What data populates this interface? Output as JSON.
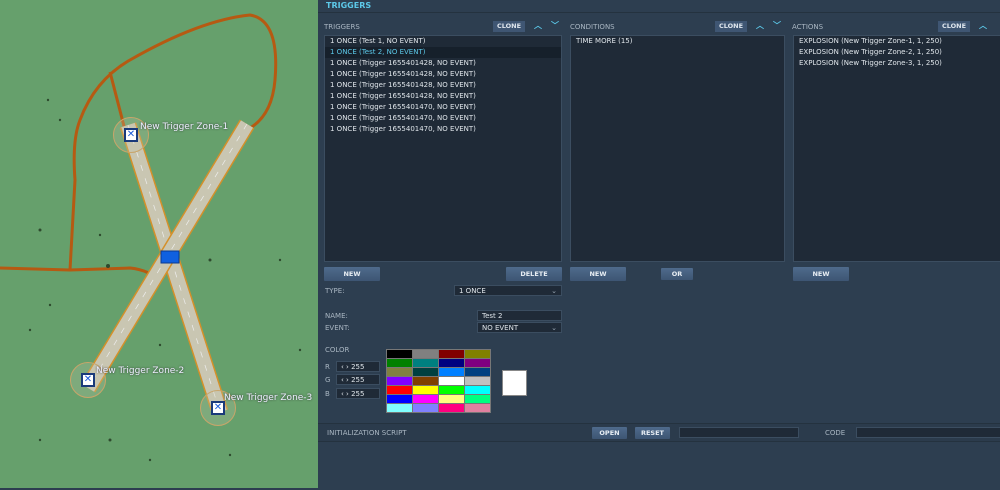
{
  "map": {
    "zones": [
      {
        "label": "New Trigger Zone-1"
      },
      {
        "label": "New Trigger Zone-2"
      },
      {
        "label": "New Trigger Zone-3"
      }
    ]
  },
  "header": {
    "title": "TRIGGERS"
  },
  "triggers": {
    "label": "TRIGGERS",
    "clone": "CLONE",
    "items": [
      "1 ONCE (Test 1, NO EVENT)",
      "1 ONCE (Test 2, NO EVENT)",
      "1 ONCE (Trigger 1655401428, NO EVENT)",
      "1 ONCE (Trigger 1655401428, NO EVENT)",
      "1 ONCE (Trigger 1655401428, NO EVENT)",
      "1 ONCE (Trigger 1655401428, NO EVENT)",
      "1 ONCE (Trigger 1655401470, NO EVENT)",
      "1 ONCE (Trigger 1655401470, NO EVENT)",
      "1 ONCE (Trigger 1655401470, NO EVENT)"
    ],
    "selected_index": 1,
    "new": "NEW",
    "delete": "DELETE"
  },
  "conditions": {
    "label": "CONDITIONS",
    "clone": "CLONE",
    "items": [
      "TIME MORE (15)"
    ],
    "new": "NEW",
    "or": "OR"
  },
  "actions": {
    "label": "ACTIONS",
    "clone": "CLONE",
    "items": [
      "EXPLOSION (New Trigger Zone-1, 1, 250)",
      "EXPLOSION (New Trigger Zone-2, 1, 250)",
      "EXPLOSION (New Trigger Zone-3, 1, 250)"
    ],
    "new": "NEW"
  },
  "form": {
    "type_label": "TYPE:",
    "type_value": "1 ONCE",
    "name_label": "NAME:",
    "name_value": "Test 2",
    "event_label": "EVENT:",
    "event_value": "NO EVENT"
  },
  "color": {
    "label": "COLOR",
    "r_label": "R",
    "g_label": "G",
    "b_label": "B",
    "r": "255",
    "g": "255",
    "b": "255",
    "selected": "#ffffff",
    "palette": [
      "#000000",
      "#808080",
      "#800000",
      "#808000",
      "#008000",
      "#008080",
      "#000080",
      "#800080",
      "#808040",
      "#004040",
      "#0080ff",
      "#004080",
      "#8000ff",
      "#804000",
      "#ffffff",
      "#c0c0c0",
      "#ff0000",
      "#ffff00",
      "#00ff00",
      "#00ffff",
      "#0000ff",
      "#ff00ff",
      "#ffff80",
      "#00ff80",
      "#80ffff",
      "#8080ff",
      "#ff0080",
      "#e080a0"
    ]
  },
  "init": {
    "label": "INITIALIZATION SCRIPT",
    "open": "OPEN",
    "reset": "RESET",
    "script_value": "",
    "code_label": "CODE",
    "code_value": ""
  },
  "colors": {
    "accent": "#5cc8e8",
    "panel": "#2d3e50",
    "terrain": "#66a06c",
    "road": "#b85a10"
  }
}
